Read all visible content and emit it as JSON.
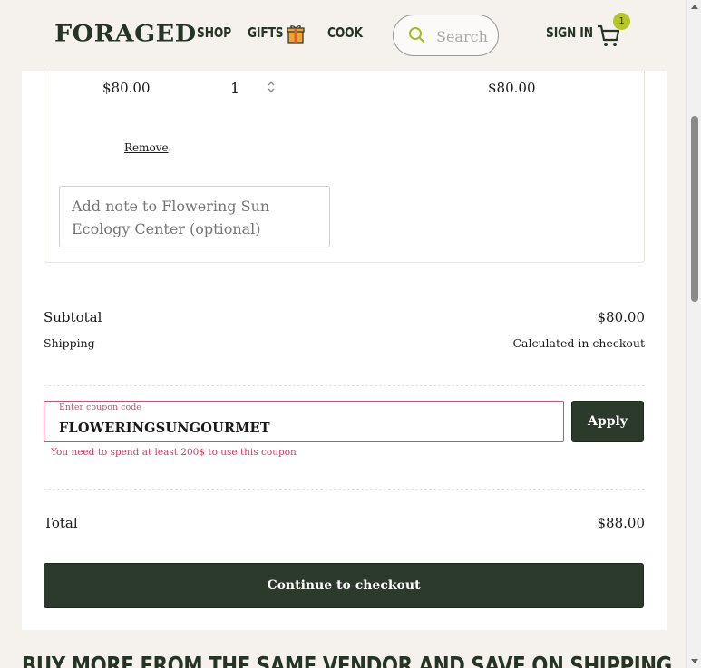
{
  "header": {
    "logo": "FORAGED",
    "nav": {
      "shop": "SHOP",
      "gifts": "GIFTS",
      "cook": "COOK"
    },
    "search_placeholder": "Search",
    "sign_in": "SIGN IN",
    "cart_count": "1"
  },
  "item": {
    "unit_price": "$80.00",
    "quantity": "1",
    "line_total": "$80.00",
    "remove_label": "Remove",
    "note_placeholder": "Add note to Flowering Sun Ecology Center (optional)"
  },
  "summary": {
    "subtotal_label": "Subtotal",
    "subtotal_value": "$80.00",
    "shipping_label": "Shipping",
    "shipping_value": "Calculated in checkout",
    "total_label": "Total",
    "total_value": "$88.00"
  },
  "coupon": {
    "label": "Enter coupon code",
    "value": "FLOWERINGSUNGOURMET",
    "apply_label": "Apply",
    "error": "You need to spend at least 200$ to use this coupon"
  },
  "checkout_label": "Continue to checkout",
  "section_heading": "BUY MORE FROM THE SAME VENDOR AND SAVE ON SHIPPING",
  "colors": {
    "brand_dark": "#2b3a2b",
    "accent_green": "#b5c726",
    "error": "#d44b6c",
    "background": "#f5f1ec"
  },
  "icons": [
    "gift-icon",
    "search-icon",
    "cart-icon",
    "quantity-stepper-icon"
  ]
}
